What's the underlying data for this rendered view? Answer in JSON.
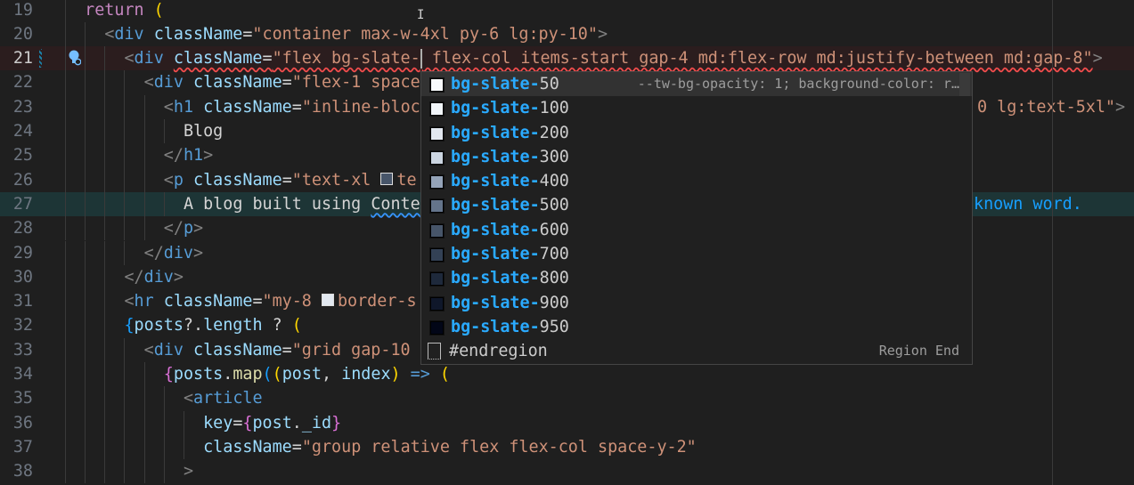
{
  "editor": {
    "current_line": 21,
    "lines": [
      {
        "n": "19",
        "indent": 2,
        "seg": [
          [
            "kw",
            "return "
          ],
          [
            "b1",
            "("
          ]
        ]
      },
      {
        "n": "20",
        "indent": 4,
        "seg": [
          [
            "tag",
            "<"
          ],
          [
            "name",
            "div"
          ],
          [
            "text",
            " "
          ],
          [
            "attr",
            "className"
          ],
          [
            "op",
            "="
          ],
          [
            "str",
            "\"container max-w-4xl py-6 lg:py-10\""
          ],
          [
            "tag",
            ">"
          ]
        ]
      },
      {
        "n": "21",
        "indent": 6,
        "seg": [
          [
            "tag",
            "<"
          ],
          [
            "name",
            "div"
          ],
          [
            "text",
            " "
          ],
          [
            "attr",
            "className",
            "sq-red"
          ],
          [
            "op",
            "=",
            "sq-red"
          ],
          [
            "str",
            "\"flex bg-slate-",
            "sq-red"
          ],
          [
            "cursor",
            ""
          ],
          [
            "str",
            " flex-col items-start gap-4 md:flex-row md:justify-between md:gap-8\"",
            "sq-red"
          ],
          [
            "tag",
            ">"
          ]
        ]
      },
      {
        "n": "22",
        "indent": 8,
        "seg": [
          [
            "tag",
            "<"
          ],
          [
            "name",
            "div"
          ],
          [
            "text",
            " "
          ],
          [
            "attr",
            "className"
          ],
          [
            "op",
            "="
          ],
          [
            "str",
            "\"flex-1 space"
          ]
        ]
      },
      {
        "n": "23",
        "indent": 10,
        "seg": [
          [
            "tag",
            "<"
          ],
          [
            "name",
            "h1"
          ],
          [
            "text",
            " "
          ],
          [
            "attr",
            "className"
          ],
          [
            "op",
            "="
          ],
          [
            "str",
            "\"inline-bloc"
          ]
        ],
        "right": [
          [
            "str",
            "0 lg:text-5xl\""
          ],
          [
            "tag",
            ">"
          ]
        ]
      },
      {
        "n": "24",
        "indent": 12,
        "seg": [
          [
            "text",
            "Blog"
          ]
        ]
      },
      {
        "n": "25",
        "indent": 10,
        "seg": [
          [
            "tag",
            "</"
          ],
          [
            "name",
            "h1"
          ],
          [
            "tag",
            ">"
          ]
        ]
      },
      {
        "n": "26",
        "indent": 10,
        "seg": [
          [
            "tag",
            "<"
          ],
          [
            "name",
            "p"
          ],
          [
            "text",
            " "
          ],
          [
            "attr",
            "className"
          ],
          [
            "op",
            "="
          ],
          [
            "str",
            "\"text-xl "
          ],
          [
            "swatch",
            "#475569"
          ],
          [
            "str",
            "te"
          ]
        ]
      },
      {
        "n": "27",
        "indent": 12,
        "seg": [
          [
            "text",
            "A blog built using "
          ],
          [
            "text",
            "Conte",
            "sq-blue"
          ]
        ],
        "right": [
          [
            "b3",
            "known word."
          ]
        ]
      },
      {
        "n": "28",
        "indent": 10,
        "seg": [
          [
            "tag",
            "</"
          ],
          [
            "name",
            "p"
          ],
          [
            "tag",
            ">"
          ]
        ]
      },
      {
        "n": "29",
        "indent": 8,
        "seg": [
          [
            "tag",
            "</"
          ],
          [
            "name",
            "div"
          ],
          [
            "tag",
            ">"
          ]
        ]
      },
      {
        "n": "30",
        "indent": 6,
        "seg": [
          [
            "tag",
            "</"
          ],
          [
            "name",
            "div"
          ],
          [
            "tag",
            ">"
          ]
        ]
      },
      {
        "n": "31",
        "indent": 6,
        "seg": [
          [
            "tag",
            "<"
          ],
          [
            "name",
            "hr"
          ],
          [
            "text",
            " "
          ],
          [
            "attr",
            "className"
          ],
          [
            "op",
            "="
          ],
          [
            "str",
            "\"my-8 "
          ],
          [
            "swatch",
            "#e2e8f0"
          ],
          [
            "str",
            "border-s"
          ]
        ]
      },
      {
        "n": "32",
        "indent": 6,
        "seg": [
          [
            "b3",
            "{"
          ],
          [
            "var",
            "posts"
          ],
          [
            "op",
            "?."
          ],
          [
            "var",
            "length"
          ],
          [
            "op",
            " ? "
          ],
          [
            "b1",
            "("
          ]
        ]
      },
      {
        "n": "33",
        "indent": 8,
        "seg": [
          [
            "tag",
            "<"
          ],
          [
            "name",
            "div"
          ],
          [
            "text",
            " "
          ],
          [
            "attr",
            "className"
          ],
          [
            "op",
            "="
          ],
          [
            "str",
            "\"grid gap-10"
          ]
        ]
      },
      {
        "n": "34",
        "indent": 10,
        "seg": [
          [
            "b2",
            "{"
          ],
          [
            "var",
            "posts"
          ],
          [
            "op",
            "."
          ],
          [
            "fn",
            "map"
          ],
          [
            "b3",
            "("
          ],
          [
            "b1",
            "("
          ],
          [
            "var",
            "post"
          ],
          [
            "op",
            ", "
          ],
          [
            "var",
            "index"
          ],
          [
            "b1",
            ")"
          ],
          [
            "name",
            " => "
          ],
          [
            "b1",
            "("
          ]
        ]
      },
      {
        "n": "35",
        "indent": 12,
        "seg": [
          [
            "tag",
            "<"
          ],
          [
            "name",
            "article"
          ]
        ]
      },
      {
        "n": "36",
        "indent": 14,
        "seg": [
          [
            "attr",
            "key"
          ],
          [
            "op",
            "="
          ],
          [
            "b2",
            "{"
          ],
          [
            "var",
            "post"
          ],
          [
            "op",
            "."
          ],
          [
            "var",
            "_id"
          ],
          [
            "b2",
            "}"
          ]
        ]
      },
      {
        "n": "37",
        "indent": 14,
        "seg": [
          [
            "attr",
            "className"
          ],
          [
            "op",
            "="
          ],
          [
            "str",
            "\"group relative flex flex-col space-y-2\""
          ]
        ]
      },
      {
        "n": "38",
        "indent": 12,
        "seg": [
          [
            "tag",
            ">"
          ]
        ]
      }
    ]
  },
  "suggest": {
    "match_prefix": "bg-slate-",
    "items": [
      {
        "suffix": "50",
        "color": "#f8fafc",
        "detail": "--tw-bg-opacity: 1; background-color: r…",
        "selected": true
      },
      {
        "suffix": "100",
        "color": "#f1f5f9"
      },
      {
        "suffix": "200",
        "color": "#e2e8f0"
      },
      {
        "suffix": "300",
        "color": "#cbd5e1"
      },
      {
        "suffix": "400",
        "color": "#94a3b8"
      },
      {
        "suffix": "500",
        "color": "#64748b"
      },
      {
        "suffix": "600",
        "color": "#475569"
      },
      {
        "suffix": "700",
        "color": "#334155"
      },
      {
        "suffix": "800",
        "color": "#1e293b"
      },
      {
        "suffix": "900",
        "color": "#0f172a"
      },
      {
        "suffix": "950",
        "color": "#020617"
      }
    ],
    "snippet": {
      "label": "#endregion",
      "detail": "Region End",
      "icon": "snippet-icon"
    }
  },
  "colors": {
    "accent": "#2aaaff",
    "current_line_bg": "#2b1d1e",
    "error_squiggle": "#f14c4c"
  }
}
